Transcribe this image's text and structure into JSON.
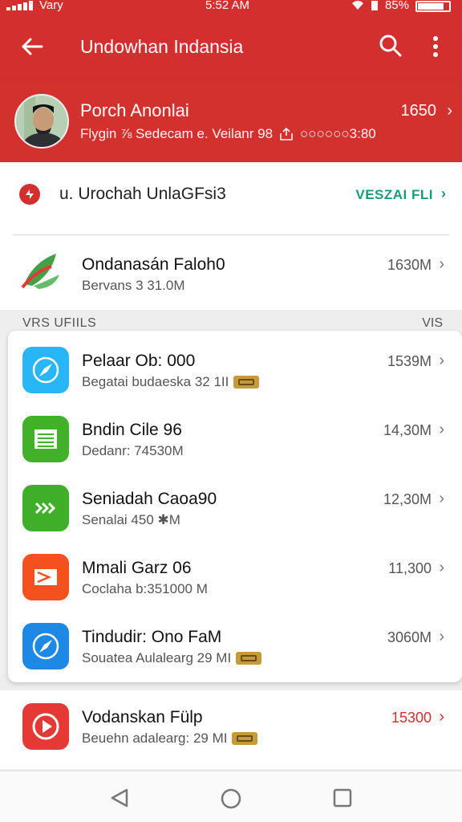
{
  "status_bar": {
    "carrier": "Vary",
    "time": "5:52 AM",
    "battery": "85%",
    "battery_level": 0.85
  },
  "app_bar": {
    "title": "Undowhan Indansia",
    "back_icon": "arrow-left-icon",
    "search_icon": "search-icon",
    "more_icon": "more-vertical-icon"
  },
  "profile": {
    "name": "Porch Anonlai",
    "subtitle": "Flygin ⅞ Sedecam e. Veilanr 98",
    "number": "○○○○○○3:80",
    "count": "1650",
    "chevron": "›"
  },
  "notice": {
    "text": "u. Urochah UnlaGFsi3",
    "link": "VESZAI FLI",
    "chevron": "›"
  },
  "featured": {
    "title": "Ondanasán Faloh0",
    "subtitle": "Bervans 3 31.0M",
    "value": "1630M",
    "chevron": "›"
  },
  "section": {
    "label": "VRS UFIILS",
    "right": "VIS"
  },
  "apps": [
    {
      "title": "Pelaar Ob: 000",
      "subtitle": "Begatai budaeska 32 1II",
      "value": "1539M",
      "color": "#29b6f6",
      "icon": "compass-icon",
      "badge": true
    },
    {
      "title": "Bndin Cile 96",
      "subtitle": "Dedanr: 74530M",
      "value": "14,30M",
      "color": "#43b02a",
      "icon": "document-icon",
      "badge": false
    },
    {
      "title": "Seniadah Caoa90",
      "subtitle": "Senalai 450 ✱M",
      "value": "12,30M",
      "color": "#3fae29",
      "icon": "fast-forward-icon",
      "badge": false
    },
    {
      "title": "Mmali Garz 06",
      "subtitle": "Coclaha b:351000 M",
      "value": "11,300",
      "color": "#f4511e",
      "icon": "mail-icon",
      "badge": false
    },
    {
      "title": "Tindudir: Ono FaM",
      "subtitle": "Souatea Aulalearg 29 MI",
      "value": "3060M",
      "color": "#1e88e5",
      "icon": "compass-icon",
      "badge": true
    }
  ],
  "bottom_app": {
    "title": "Vodanskan Fülp",
    "subtitle": "Beuehn adalearg: 29 MI",
    "value": "15300",
    "color": "#e53935",
    "icon": "play-icon",
    "badge": true,
    "chevron": "›"
  },
  "chevron": "›",
  "nav": {
    "back": "nav-back-icon",
    "home": "nav-home-icon",
    "recent": "nav-recent-icon"
  }
}
